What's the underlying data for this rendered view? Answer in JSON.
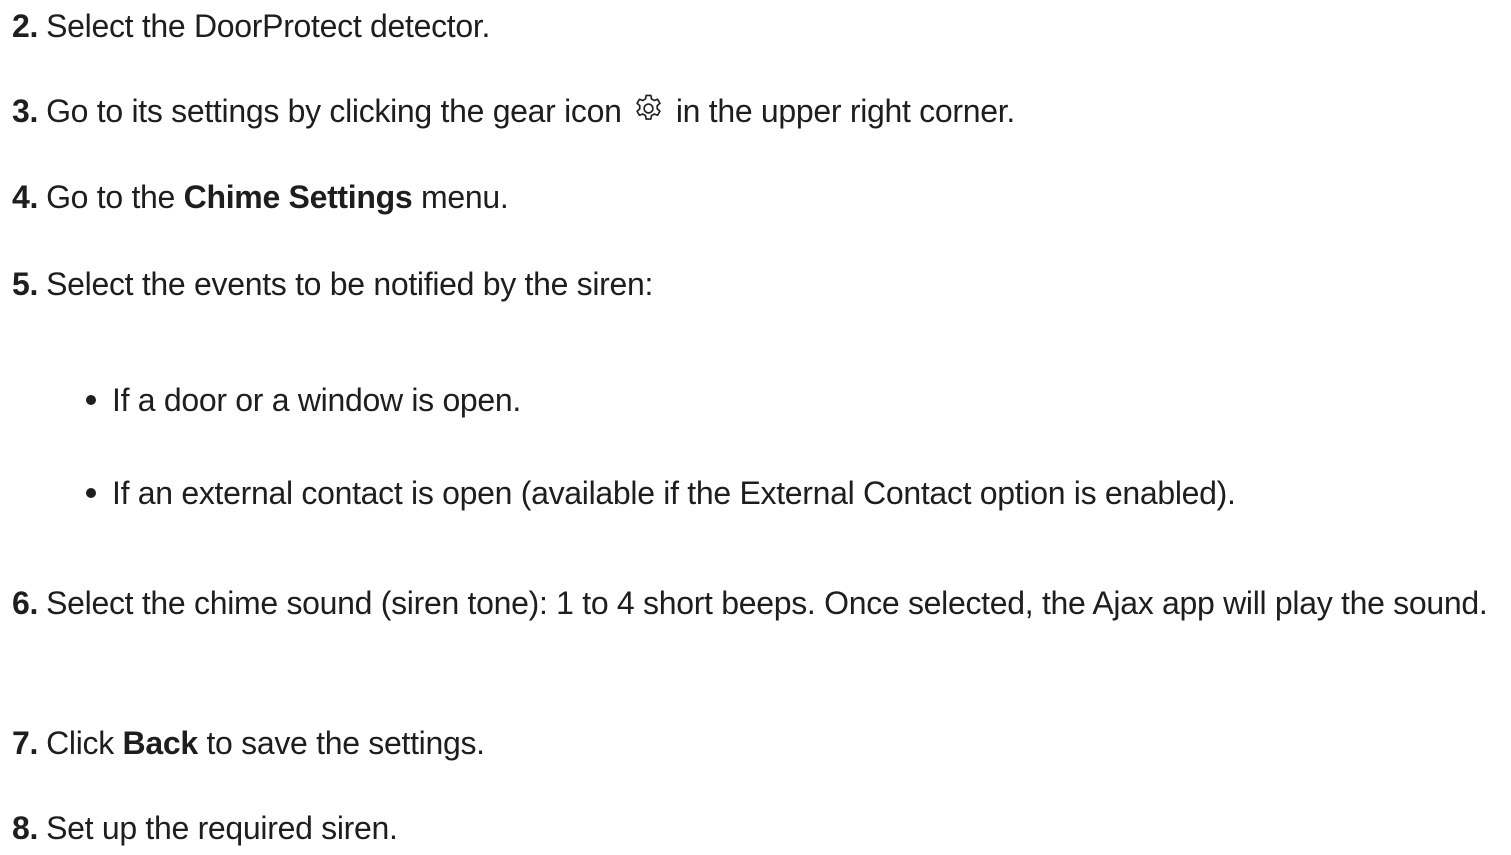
{
  "steps": [
    {
      "number": "2.",
      "text": "Select the DoorProtect detector."
    },
    {
      "number": "3.",
      "before_icon": "Go to its settings by clicking the gear icon",
      "icon": "gear-icon",
      "after_icon": "in the upper right corner."
    },
    {
      "number": "4.",
      "before_bold": "Go to the",
      "bold": "Chime Settings",
      "after_bold": "menu."
    },
    {
      "number": "5.",
      "text": "Select the events to be notified by the siren:"
    },
    {
      "number": "6.",
      "text": "Select the chime sound (siren tone): 1 to 4 short beeps. Once selected, the Ajax app will play the sound."
    },
    {
      "number": "7.",
      "before_bold": "Click",
      "bold": "Back",
      "after_bold": "to save the settings."
    },
    {
      "number": "8.",
      "text": "Set up the required siren."
    }
  ],
  "bullets": [
    "If a door or a window is open.",
    "If an external contact is open (available if the External Contact option is enabled)."
  ]
}
